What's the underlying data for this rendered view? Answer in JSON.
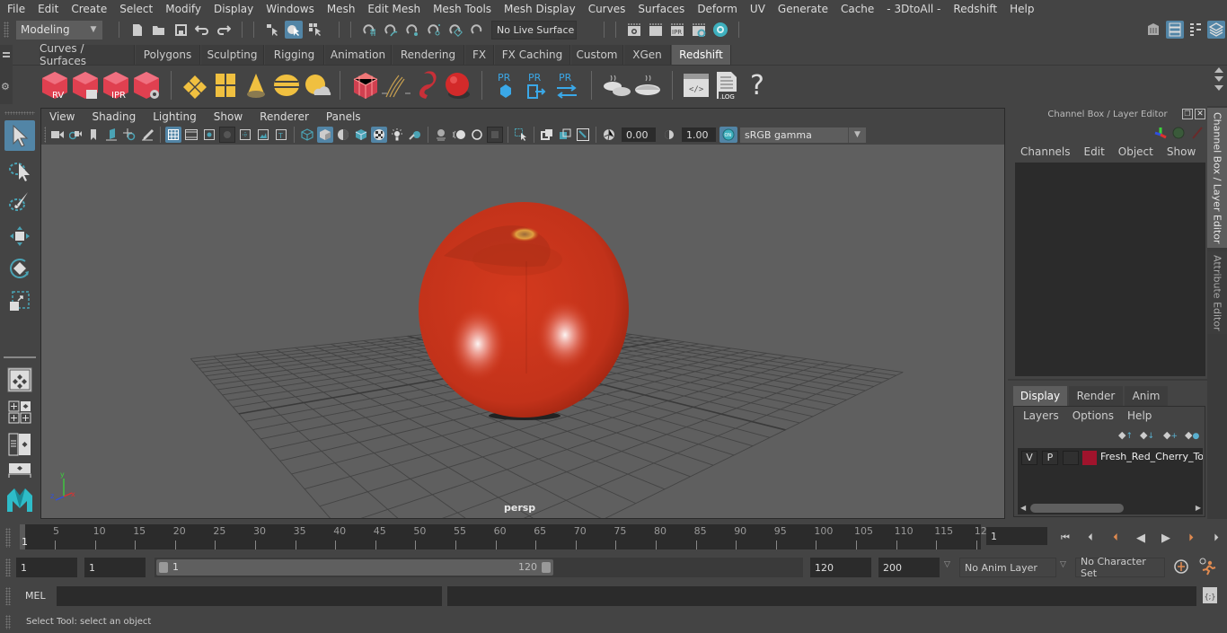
{
  "menubar": [
    "File",
    "Edit",
    "Create",
    "Select",
    "Modify",
    "Display",
    "Windows",
    "Mesh",
    "Edit Mesh",
    "Mesh Tools",
    "Mesh Display",
    "Curves",
    "Surfaces",
    "Deform",
    "UV",
    "Generate",
    "Cache",
    "- 3DtoAll -",
    "Redshift",
    "Help"
  ],
  "statusline": {
    "workspace": "Modeling",
    "live_surface": "No Live Surface"
  },
  "shelf": {
    "tabs": [
      "Curves / Surfaces",
      "Polygons",
      "Sculpting",
      "Rigging",
      "Animation",
      "Rendering",
      "FX",
      "FX Caching",
      "Custom",
      "XGen",
      "Redshift"
    ],
    "active_tab": "Redshift",
    "icons": [
      {
        "name": "redshift-render-view-icon",
        "label": "RV"
      },
      {
        "name": "redshift-batch-render-icon",
        "label": ""
      },
      {
        "name": "redshift-ipr-icon",
        "label": "IPR"
      },
      {
        "name": "redshift-render-settings-icon",
        "label": ""
      },
      {
        "name": "redshift-light-rect-icon",
        "label": ""
      },
      {
        "name": "redshift-light-portal-icon",
        "label": ""
      },
      {
        "name": "redshift-spot-light-icon",
        "label": ""
      },
      {
        "name": "redshift-dome-light-icon",
        "label": ""
      },
      {
        "name": "redshift-sun-sky-icon",
        "label": ""
      },
      {
        "name": "redshift-proxy-icon",
        "label": ""
      },
      {
        "name": "redshift-hair-icon",
        "label": ""
      },
      {
        "name": "redshift-volume-icon",
        "label": ""
      },
      {
        "name": "redshift-material-icon",
        "label": ""
      },
      {
        "name": "redshift-pr-import-icon",
        "label": "PR"
      },
      {
        "name": "redshift-pr-export-icon",
        "label": "PR"
      },
      {
        "name": "redshift-pr-convert-icon",
        "label": "PR"
      },
      {
        "name": "redshift-bake-multi-icon",
        "label": ""
      },
      {
        "name": "redshift-bake-icon",
        "label": ""
      },
      {
        "name": "redshift-script-icon",
        "label": "</>"
      },
      {
        "name": "redshift-log-icon",
        "label": ".LOG"
      },
      {
        "name": "redshift-help-icon",
        "label": "?"
      }
    ]
  },
  "viewport": {
    "menu": [
      "View",
      "Shading",
      "Lighting",
      "Show",
      "Renderer",
      "Panels"
    ],
    "exposure": "0.00",
    "gamma": "1.00",
    "color_management": "ON",
    "color_space": "sRGB gamma",
    "camera_label": "persp",
    "axis": {
      "x": "x",
      "y": "y",
      "z": "z"
    }
  },
  "channel_box": {
    "title": "Channel Box / Layer Editor",
    "menu": [
      "Channels",
      "Edit",
      "Object",
      "Show"
    ]
  },
  "layer_editor": {
    "tabs": [
      "Display",
      "Render",
      "Anim"
    ],
    "active_tab": "Display",
    "menu": [
      "Layers",
      "Options",
      "Help"
    ],
    "layers": [
      {
        "visible": "V",
        "playback": "P",
        "type": "",
        "color": "#a0132c",
        "name": "Fresh_Red_Cherry_Tom"
      }
    ]
  },
  "side_tabs": [
    "Channel Box / Layer Editor",
    "Attribute Editor"
  ],
  "timeline": {
    "ticks": [
      "5",
      "10",
      "15",
      "20",
      "25",
      "30",
      "35",
      "40",
      "45",
      "50",
      "55",
      "60",
      "65",
      "70",
      "75",
      "80",
      "85",
      "90",
      "95",
      "100",
      "105",
      "110",
      "115",
      "12"
    ],
    "current_frame_marker": "1",
    "current_frame": "1"
  },
  "range": {
    "start": "1",
    "playback_start": "1",
    "slider_start": "1",
    "slider_end": "120",
    "playback_end": "120",
    "end": "200",
    "anim_layer": "No Anim Layer",
    "character_set": "No Character Set"
  },
  "command": {
    "language": "MEL",
    "input": "",
    "result": ""
  },
  "help_line": "Select Tool: select an object"
}
